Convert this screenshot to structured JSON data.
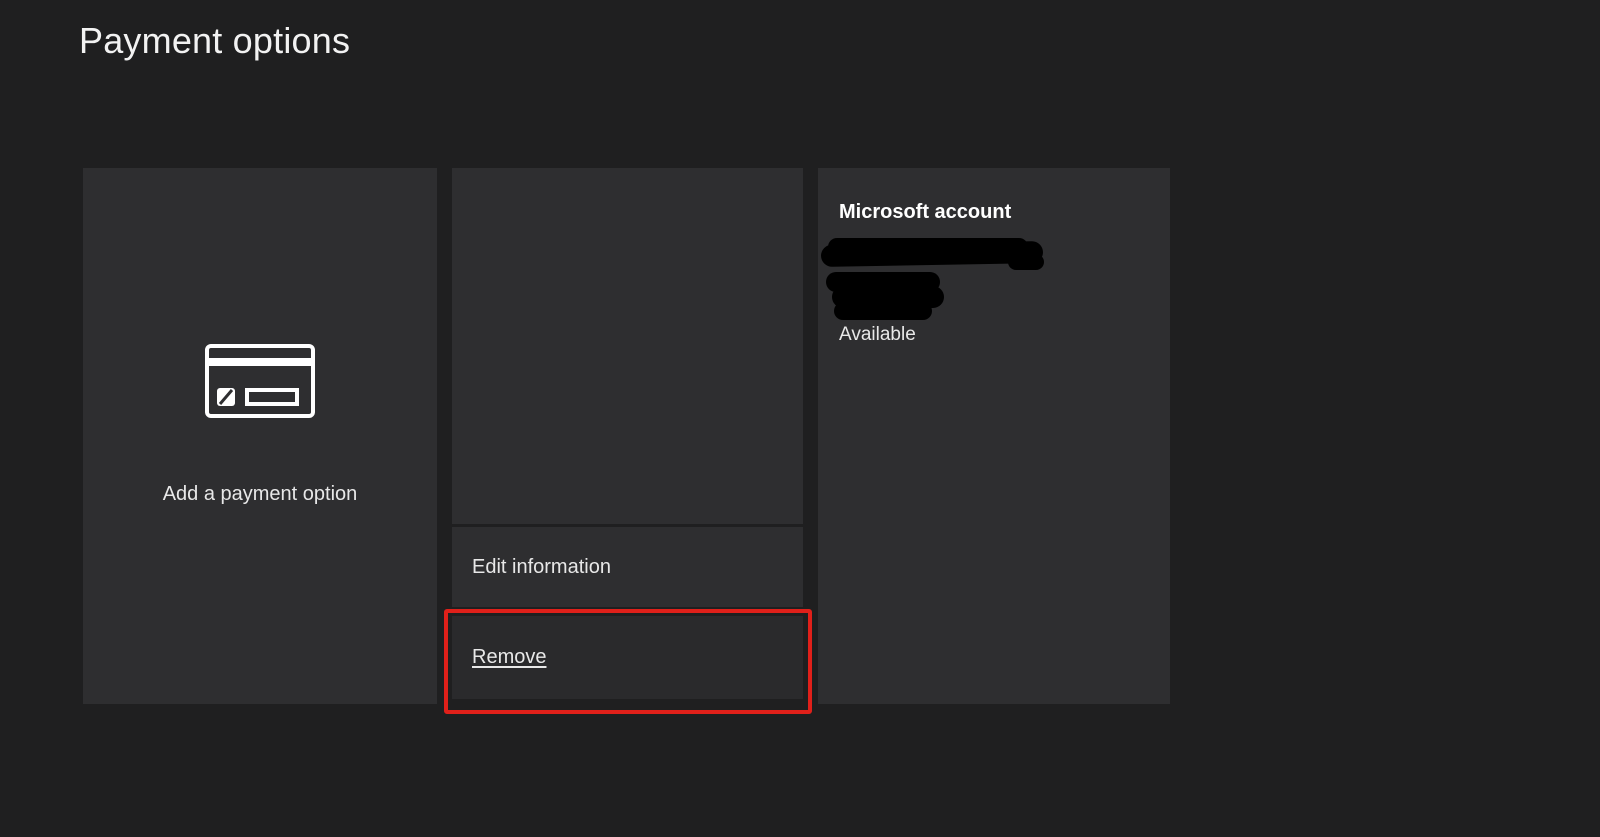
{
  "page": {
    "title": "Payment options"
  },
  "add_tile": {
    "label": "Add a payment option",
    "icon": "credit-card-icon"
  },
  "card_menu": {
    "edit_label": "Edit information",
    "remove_label": "Remove"
  },
  "microsoft_account": {
    "title": "Microsoft account",
    "status": "Available"
  },
  "colors": {
    "background": "#1f1f20",
    "tile": "#2e2e30",
    "highlight": "#e0201a"
  }
}
